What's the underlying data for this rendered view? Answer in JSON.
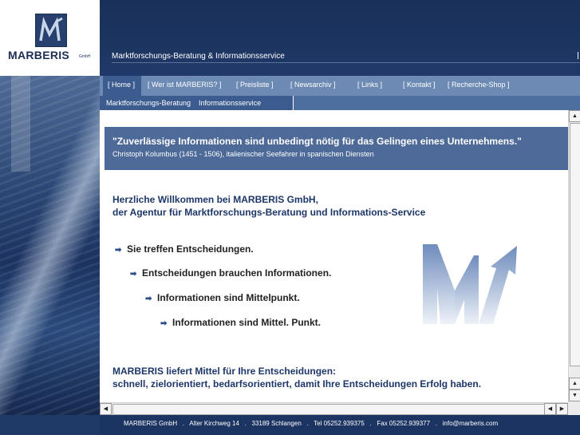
{
  "header": {
    "logo_text": "MARBERIS",
    "logo_suffix": "GmbH",
    "tagline": "Marktforschungs-Beratung & Informationsservice"
  },
  "nav": {
    "items": [
      {
        "label": "[ Home ]"
      },
      {
        "label": "[ Wer ist MARBERIS? ]"
      },
      {
        "label": "[ Preisliste ]"
      },
      {
        "label": "[ Newsarchiv ]"
      },
      {
        "label": "[ Links ]"
      },
      {
        "label": "[ Kontakt ]"
      },
      {
        "label": "[ Recherche-Shop ]"
      }
    ],
    "sub_text": "Marktforschungs-Beratung    Informationsservice"
  },
  "content": {
    "quote": "\"Zuverlässige Informationen sind unbedingt nötig für das Gelingen eines Unternehmens.\"",
    "quote_author": "Christoph Kolumbus (1451 - 1506), italienischer Seefahrer in spanischen Diensten",
    "welcome_line1": "Herzliche Willkommen bei MARBERIS GmbH,",
    "welcome_line2": "der Agentur für Marktforschungs-Beratung und Informations-Service",
    "bullets": [
      "Sie treffen Entscheidungen.",
      "Entscheidungen brauchen Informationen.",
      "Informationen sind Mittelpunkt.",
      "Informationen sind Mittel. Punkt."
    ],
    "closing_line1": "MARBERIS liefert Mittel für Ihre Entscheidungen:",
    "closing_line2": "schnell, zielorientiert, bedarfsorientiert, damit Ihre Entscheidungen Erfolg haben."
  },
  "footer": {
    "text": "MARBERIS GmbH   .   Alter Kirchweg 14   .   33189 Schlangen   .   Tel 05252.939375   .   Fax 05252.939377   .   info@marberis.com"
  },
  "colors": {
    "header": "#19305a",
    "nav": "#6c8ab4",
    "nav_active": "#3c5b8f",
    "quote_box": "#4d6a99",
    "heading_text": "#1d3768"
  },
  "icons": {
    "logo": "marberis-m-logo-icon",
    "bullet": "arrow-right-icon",
    "scroll_up": "arrow-up-icon",
    "scroll_down": "arrow-down-icon",
    "scroll_left": "arrow-left-icon",
    "scroll_right": "arrow-right-icon"
  }
}
